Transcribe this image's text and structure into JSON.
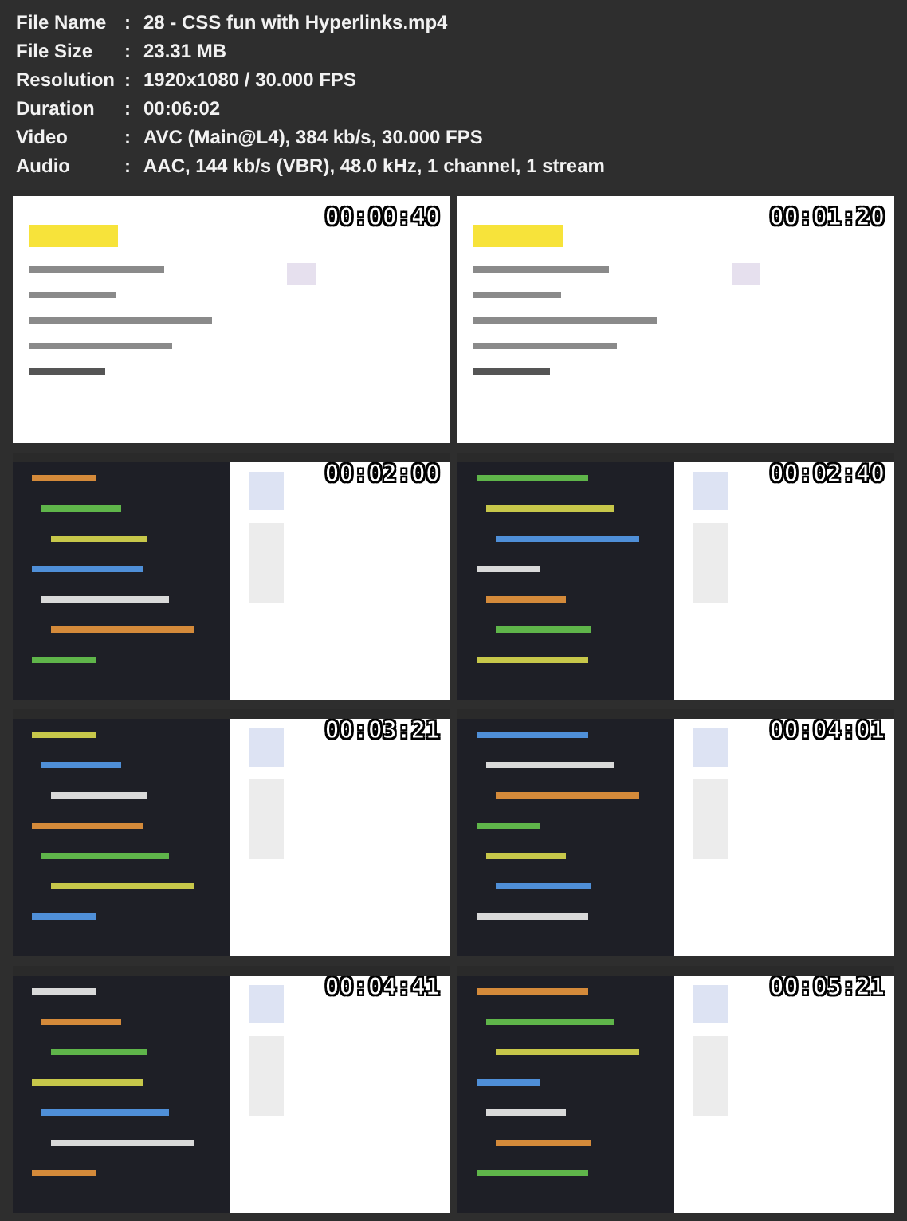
{
  "file_info": [
    {
      "label": "File Name",
      "separator": ":",
      "value": "28 - CSS fun with Hyperlinks.mp4"
    },
    {
      "label": "File Size",
      "separator": ":",
      "value": "23.31 MB"
    },
    {
      "label": "Resolution",
      "separator": ":",
      "value": "1920x1080 / 30.000 FPS"
    },
    {
      "label": "Duration",
      "separator": ":",
      "value": "00:06:02"
    },
    {
      "label": "Video",
      "separator": ":",
      "value": "AVC (Main@L4), 384 kb/s, 30.000 FPS"
    },
    {
      "label": "Audio",
      "separator": ":",
      "value": "AAC, 144 kb/s (VBR), 48.0 kHz, 1 channel, 1 stream"
    }
  ],
  "thumbnails": [
    {
      "timestamp": "00:00:40"
    },
    {
      "timestamp": "00:01:20"
    },
    {
      "timestamp": "00:02:00"
    },
    {
      "timestamp": "00:02:40"
    },
    {
      "timestamp": "00:03:21"
    },
    {
      "timestamp": "00:04:01"
    },
    {
      "timestamp": "00:04:41"
    },
    {
      "timestamp": "00:05:21"
    }
  ]
}
